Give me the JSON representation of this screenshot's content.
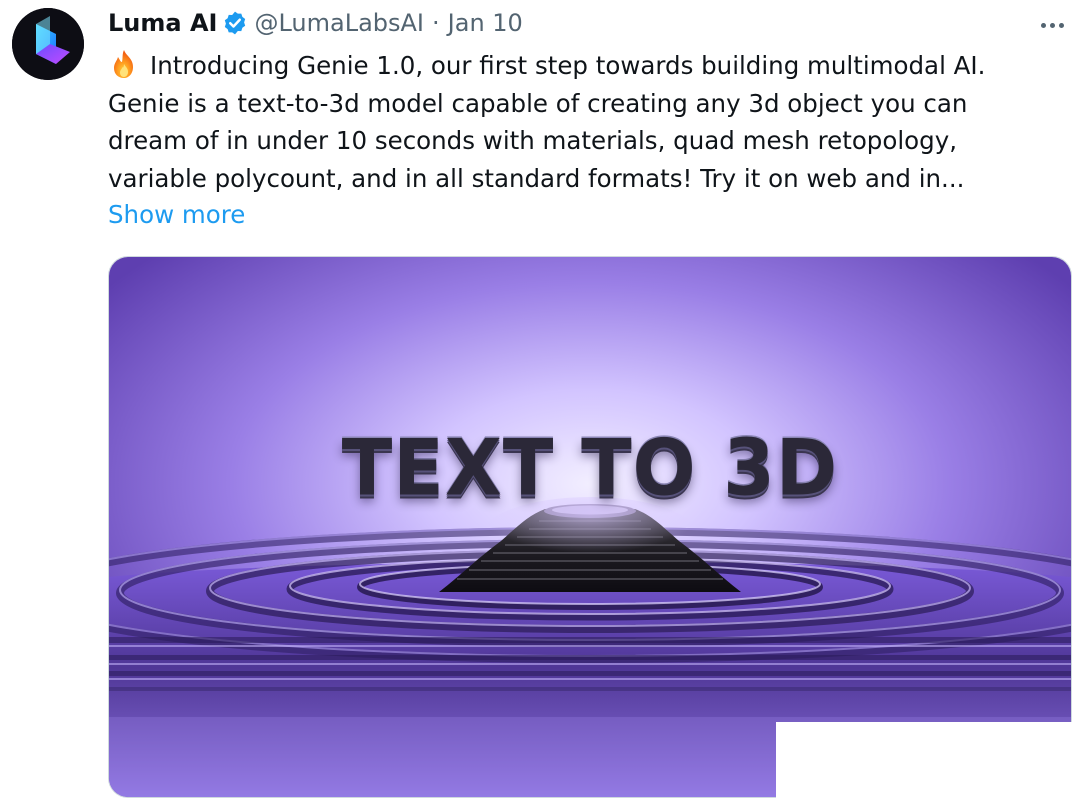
{
  "author": {
    "name": "Luma AI",
    "handle": "@LumaLabsAI",
    "separator": "·",
    "date": "Jan 10",
    "verified": true
  },
  "icons": {
    "avatar": "luma-logo",
    "badge": "verified-badge-icon",
    "menu": "more-options-icon",
    "emoji": "fire-emoji"
  },
  "tweet": {
    "lines": [
      "Introducing Genie 1.0, our first step towards building multimodal AI.",
      "Genie is a text-to-3d model capable of creating any 3d object you can",
      "dream of in under 10 seconds with materials, quad mesh retopology,",
      "variable polycount, and in all standard formats! Try it on web and in..."
    ],
    "show_more": "Show more"
  },
  "media": {
    "headline": "TEXT TO 3D"
  },
  "colors": {
    "link": "#1d9bf0",
    "text": "#0f1419",
    "muted": "#536471",
    "verified": "#1d9bf0"
  }
}
